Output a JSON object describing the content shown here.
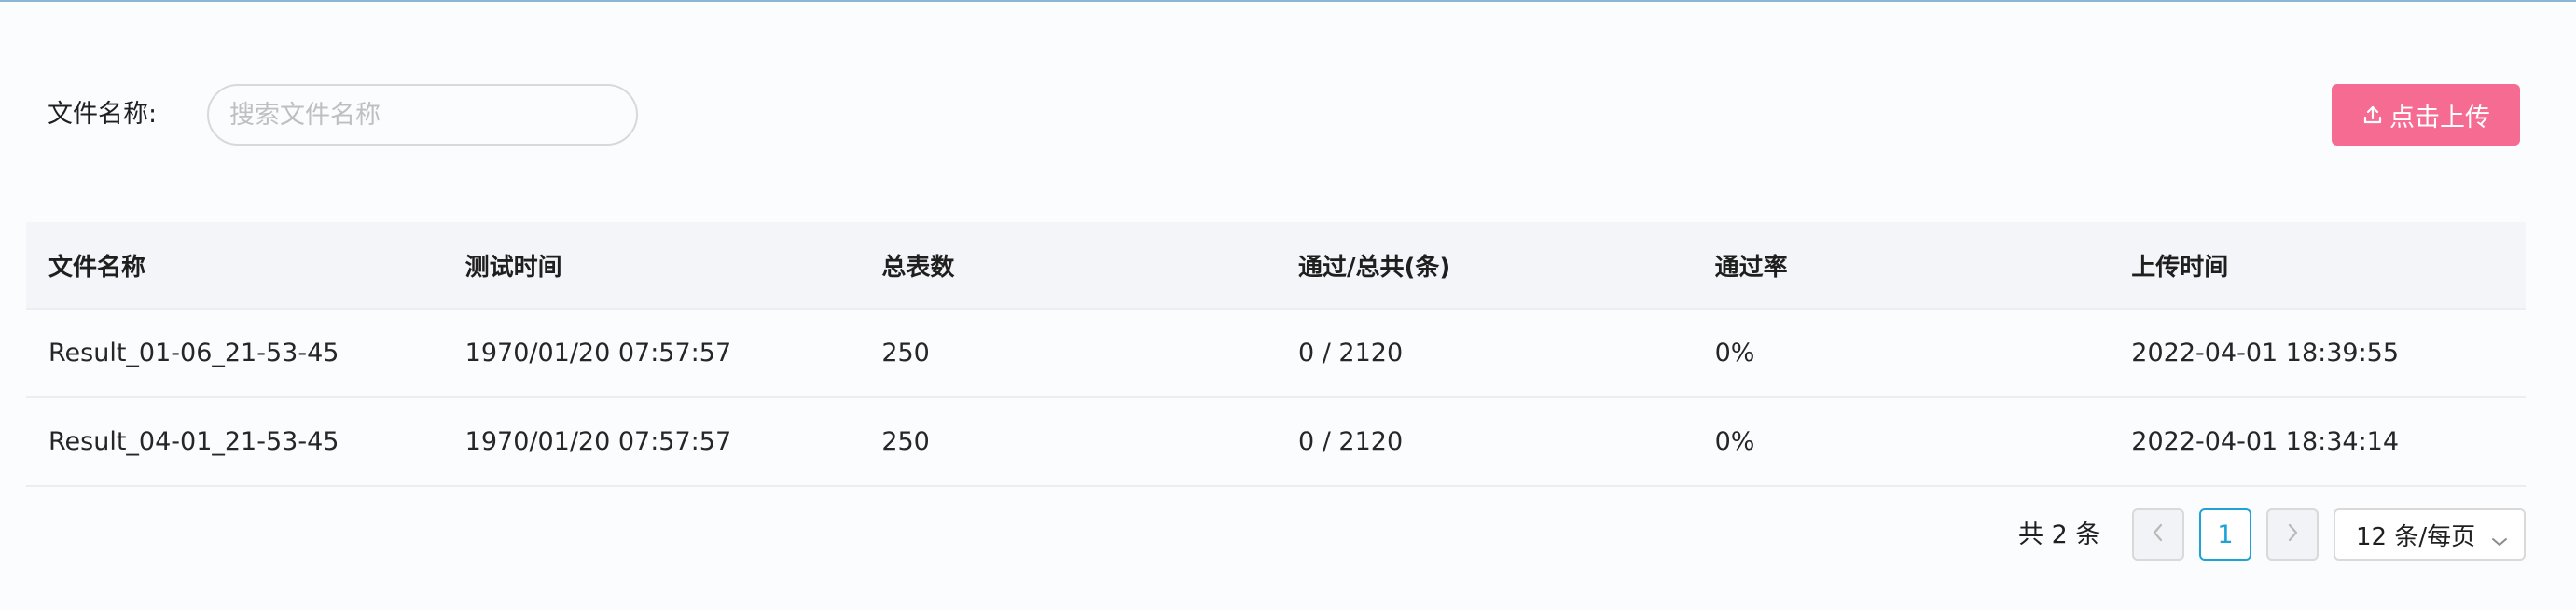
{
  "filter": {
    "label": "文件名称:",
    "search_placeholder": "搜索文件名称",
    "search_value": ""
  },
  "toolbar": {
    "upload_label": "点击上传",
    "upload_icon": "upload-icon"
  },
  "table": {
    "columns": [
      "文件名称",
      "测试时间",
      "总表数",
      "通过/总共(条)",
      "通过率",
      "上传时间"
    ],
    "rows": [
      [
        "Result_01-06_21-53-45",
        "1970/01/20 07:57:57",
        "250",
        "0 / 2120",
        "0%",
        "2022-04-01 18:39:55"
      ],
      [
        "Result_04-01_21-53-45",
        "1970/01/20 07:57:57",
        "250",
        "0 / 2120",
        "0%",
        "2022-04-01 18:34:14"
      ]
    ]
  },
  "pagination": {
    "total_label": "共 2 条",
    "current_page": "1",
    "page_size_label": "12 条/每页",
    "prev_icon": "chevron-left-icon",
    "next_icon": "chevron-right-icon"
  },
  "colors": {
    "accent": "#f56b91",
    "active_page": "#1fa3d6"
  }
}
